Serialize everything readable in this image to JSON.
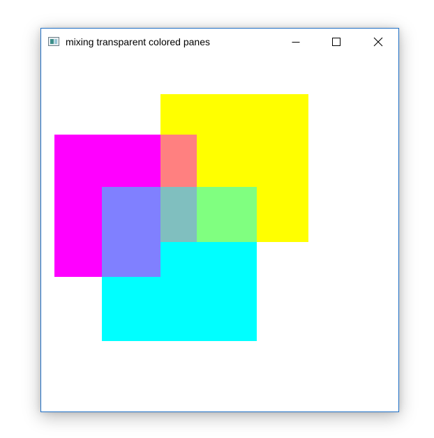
{
  "window": {
    "title": "mixing transparent colored panes",
    "icon": "app-window-icon",
    "controls": {
      "minimize": "minimize-icon",
      "maximize": "maximize-icon",
      "close": "close-icon"
    },
    "border_color": "#1f6fc5"
  },
  "panes": {
    "magenta": "#ff00ff",
    "yellow": "#ffff00",
    "cyan": "#00ffff",
    "magenta_yellow_mix": "#ff8080",
    "magenta_cyan_mix": "#8080ff",
    "yellow_cyan_mix": "#80ff80",
    "all_three_mix": "#80bfbf"
  }
}
